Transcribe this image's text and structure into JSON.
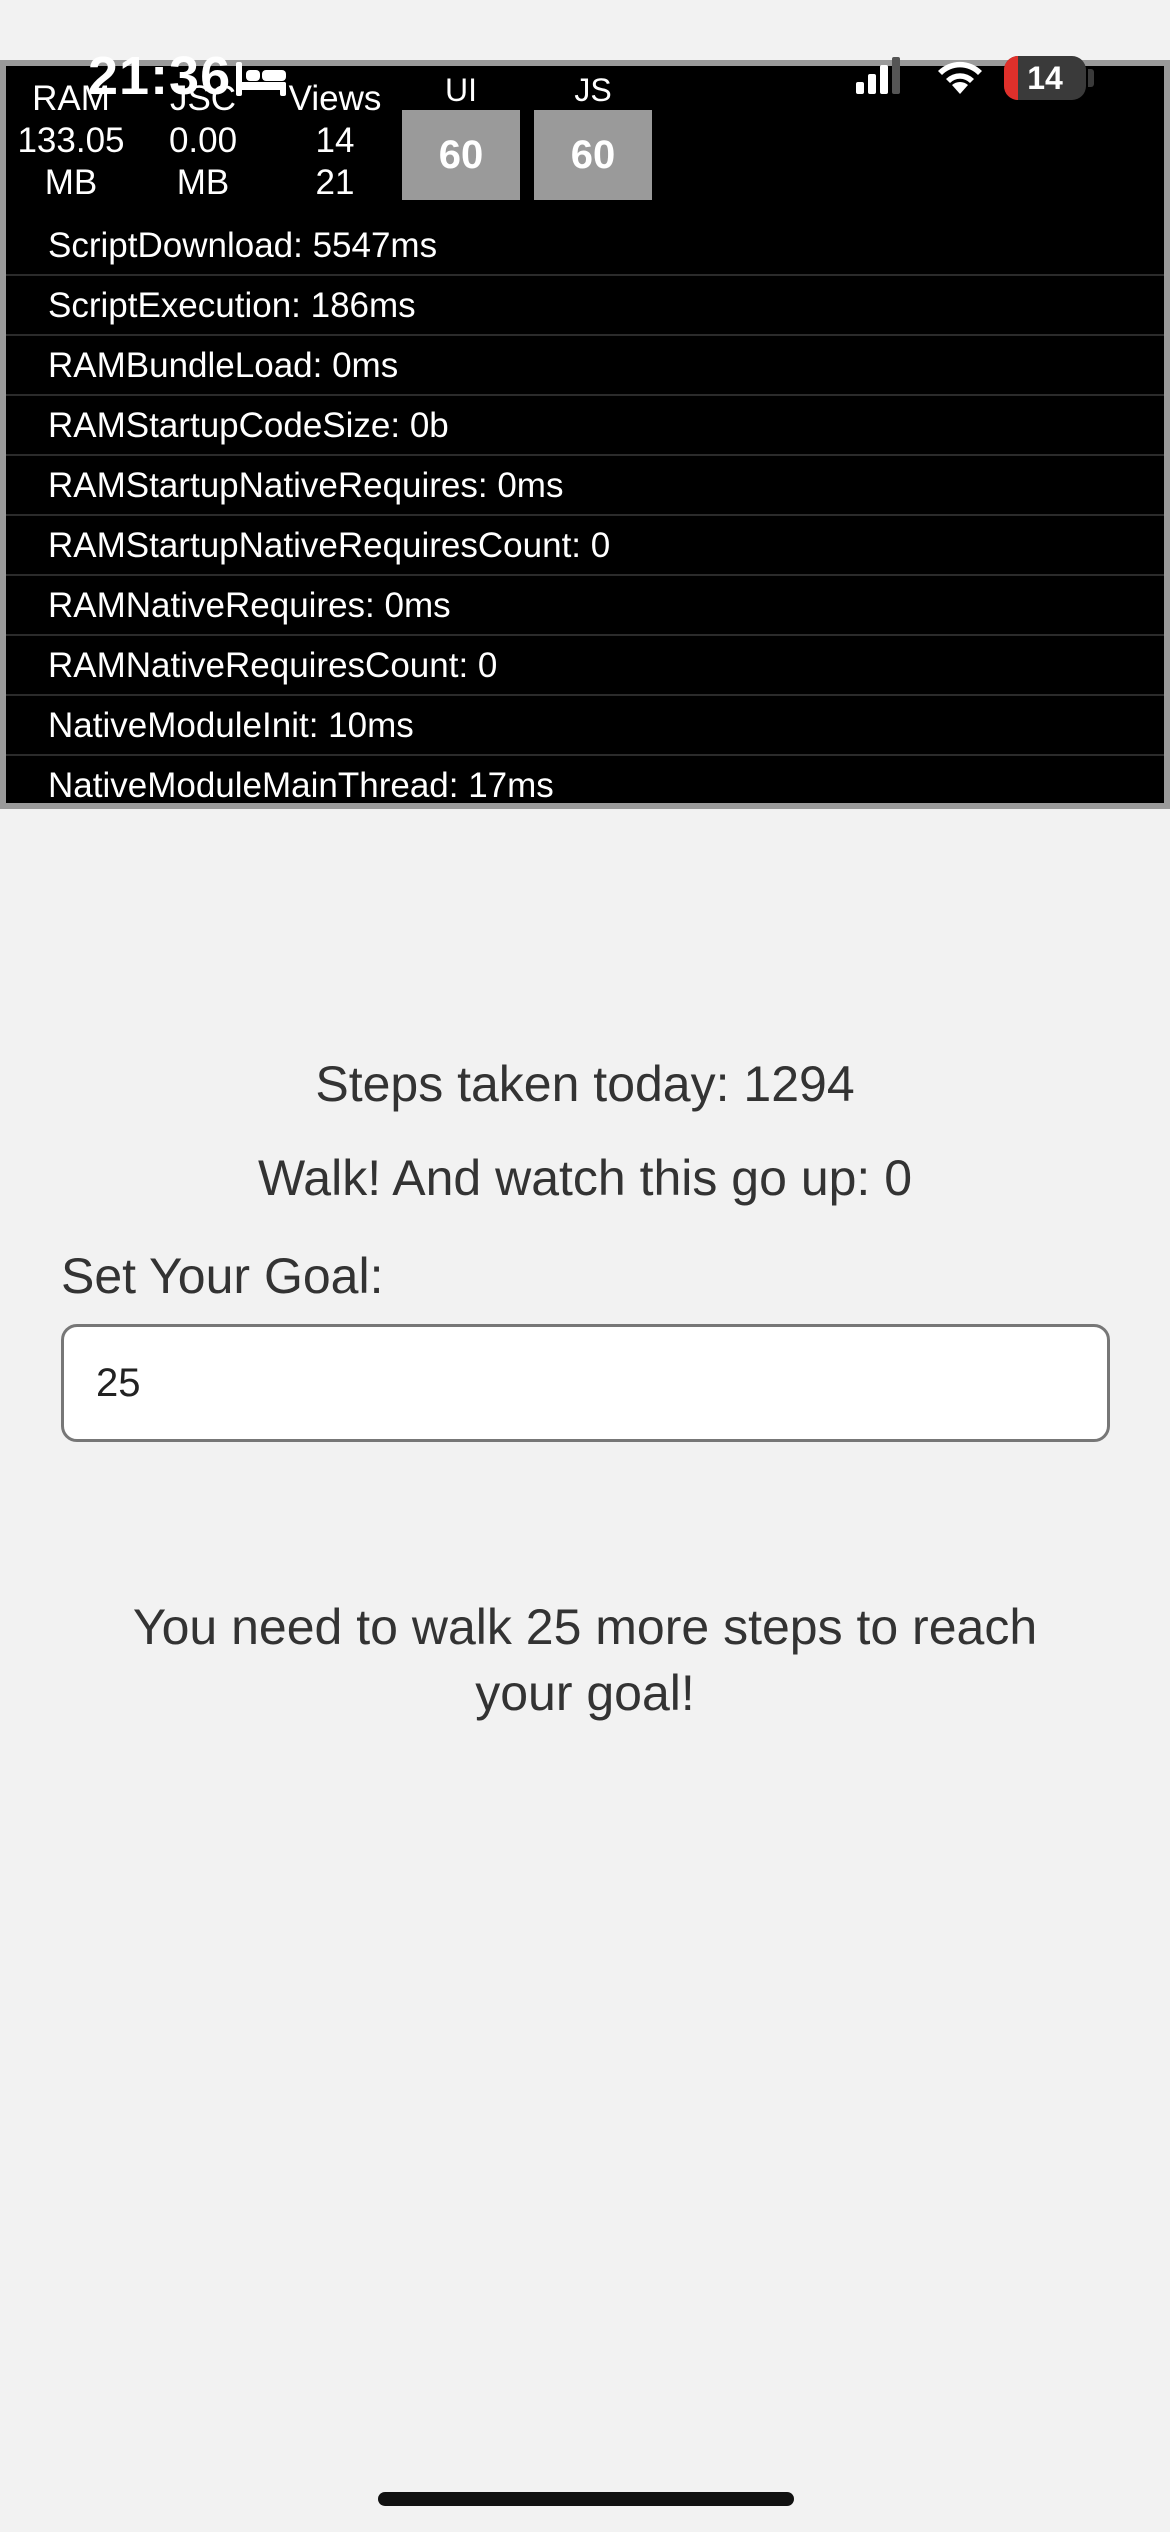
{
  "status_bar": {
    "time": "21:36",
    "battery_level": "14"
  },
  "perf_monitor": {
    "stats": [
      {
        "label": "RAM",
        "value": "133.05",
        "unit": "MB"
      },
      {
        "label": "JSC",
        "value": "0.00",
        "unit": "MB"
      },
      {
        "label": "Views",
        "value": "14",
        "unit": "21"
      }
    ],
    "fps": [
      {
        "label": "UI",
        "value": "60"
      },
      {
        "label": "JS",
        "value": "60"
      }
    ],
    "metrics": [
      "ScriptDownload: 5547ms",
      "ScriptExecution: 186ms",
      "RAMBundleLoad: 0ms",
      "RAMStartupCodeSize: 0b",
      "RAMStartupNativeRequires: 0ms",
      "RAMStartupNativeRequiresCount: 0",
      "RAMNativeRequires: 0ms",
      "RAMNativeRequiresCount: 0",
      "NativeModuleInit: 10ms",
      "NativeModuleMainThread: 17ms"
    ]
  },
  "main": {
    "steps_today": "Steps taken today: 1294",
    "walk_counter": "Walk! And watch this go up: 0",
    "goal_label": "Set Your Goal:",
    "goal_value": "25",
    "remaining_message": "You need to walk 25 more steps to reach your goal!"
  },
  "colors": {
    "background": "#f2f2f2",
    "overlay": "#000000",
    "fps_box": "#9a9a9a",
    "battery_low": "#e0302b"
  }
}
